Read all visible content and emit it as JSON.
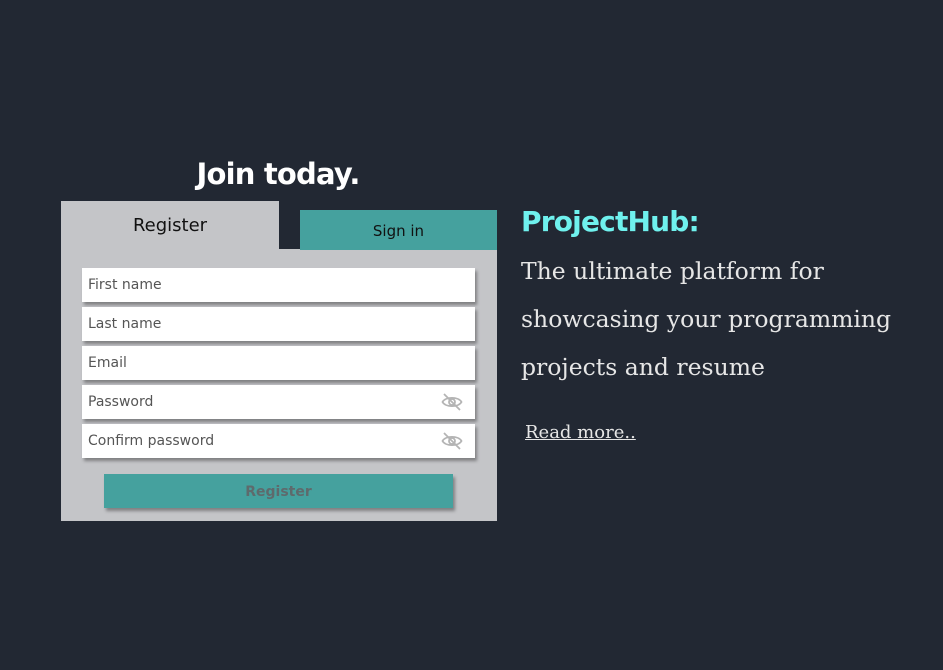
{
  "heading": "Join today.",
  "tabs": {
    "register": "Register",
    "signin": "Sign in"
  },
  "form": {
    "first_name_placeholder": "First name",
    "last_name_placeholder": "Last name",
    "email_placeholder": "Email",
    "password_placeholder": "Password",
    "confirm_password_placeholder": "Confirm password",
    "submit_label": "Register"
  },
  "hero": {
    "brand": "ProjectHub:",
    "tagline": "The ultimate platform for showcasing your programming projects and resume",
    "read_more": "Read more.."
  },
  "icons": {
    "password_toggle": "eye-slash-icon"
  },
  "colors": {
    "background": "#222833",
    "panel": "#c4c5c8",
    "accent": "#45a19e",
    "brand": "#6ff1ee"
  }
}
